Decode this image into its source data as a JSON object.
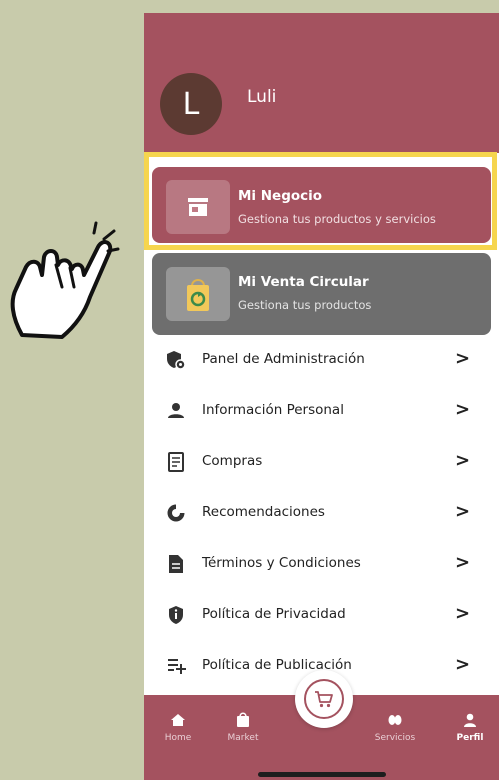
{
  "user": {
    "initial": "L",
    "name": "Luli"
  },
  "cards": [
    {
      "title": "Mi Negocio",
      "subtitle": "Gestiona tus productos y servicios",
      "icon": "store-icon"
    },
    {
      "title": "Mi Venta Circular",
      "subtitle": "Gestiona tus productos",
      "icon": "recycle-bag-icon"
    }
  ],
  "menu": [
    {
      "label": "Panel de Administración",
      "icon": "admin-shield-icon"
    },
    {
      "label": "Información Personal",
      "icon": "person-icon"
    },
    {
      "label": "Compras",
      "icon": "receipt-icon"
    },
    {
      "label": "Recomendaciones",
      "icon": "pie-icon"
    },
    {
      "label": "Términos y Condiciones",
      "icon": "document-icon"
    },
    {
      "label": "Política de Privacidad",
      "icon": "privacy-shield-icon"
    },
    {
      "label": "Política de Publicación",
      "icon": "publish-icon"
    }
  ],
  "chevron": ">",
  "nav": {
    "home": "Home",
    "market": "Market",
    "servicios": "Servicios",
    "perfil": "Perfil"
  },
  "colors": {
    "brand": "#a4525f",
    "background": "#c8cbab",
    "highlight": "#f6d54e",
    "secondary_card": "#6e6e6e"
  }
}
